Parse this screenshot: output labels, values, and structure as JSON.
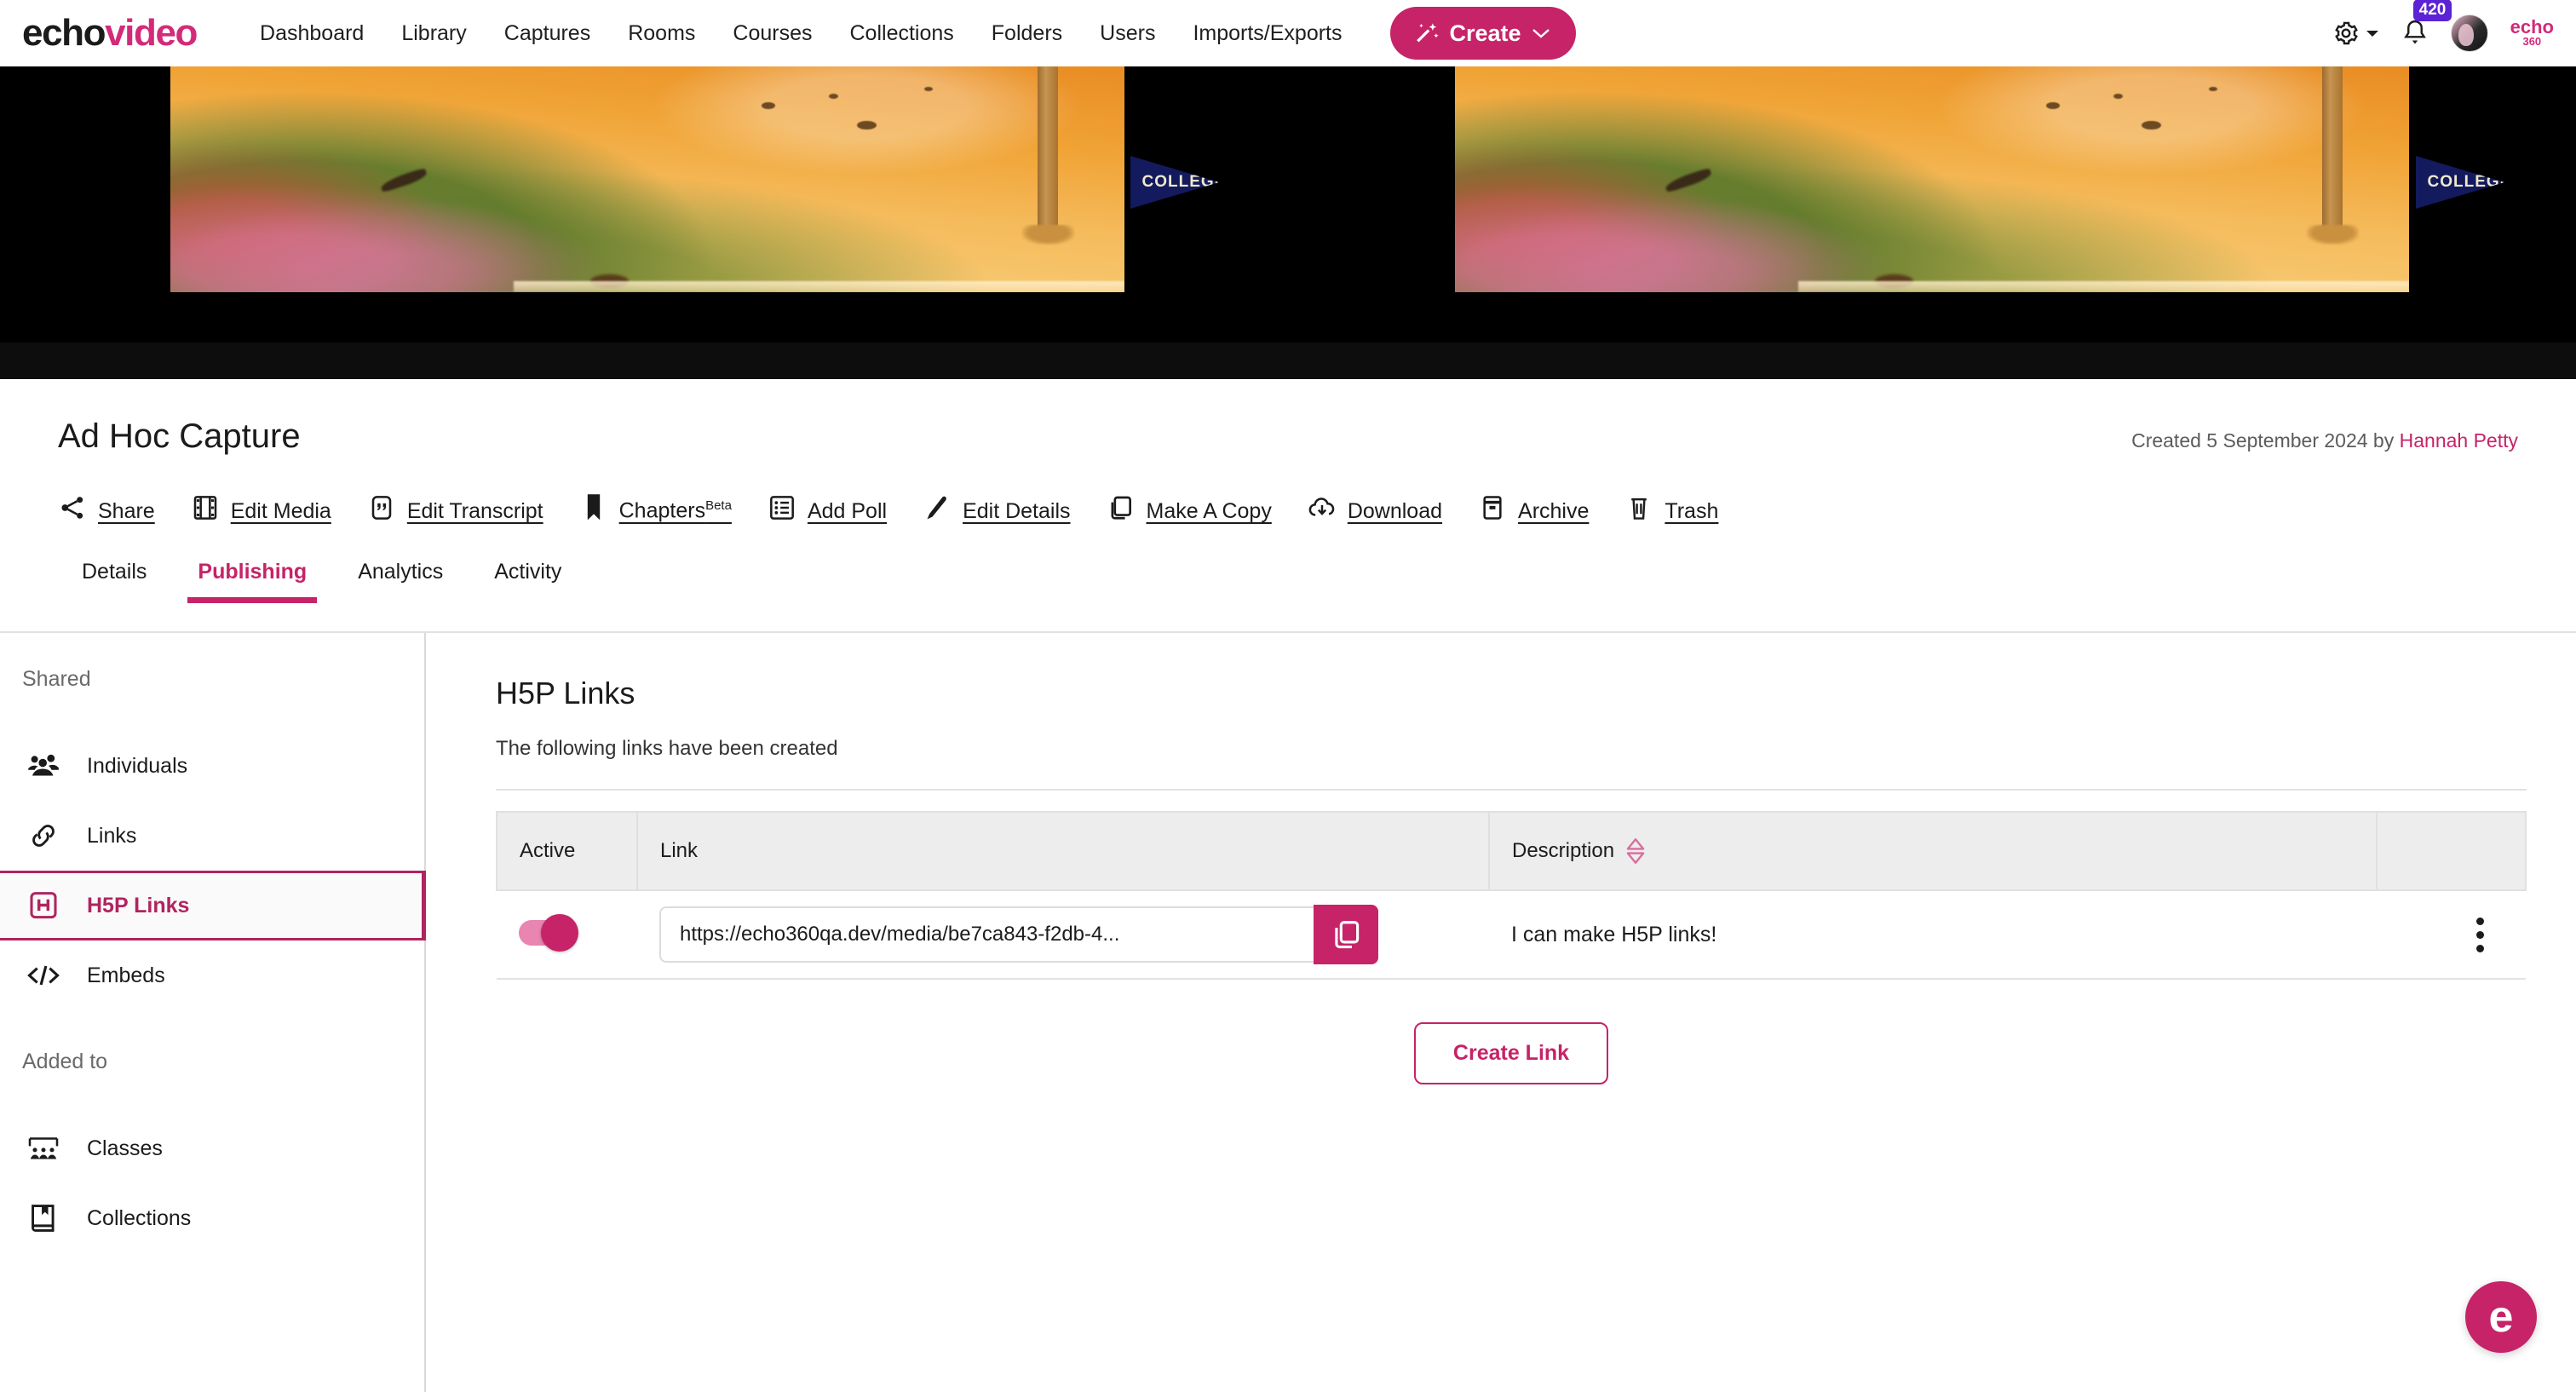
{
  "nav": {
    "logo_echo": "echo",
    "logo_video": "video",
    "links": [
      {
        "label": "Dashboard"
      },
      {
        "label": "Library"
      },
      {
        "label": "Captures"
      },
      {
        "label": "Rooms"
      },
      {
        "label": "Courses"
      },
      {
        "label": "Collections"
      },
      {
        "label": "Folders"
      },
      {
        "label": "Users"
      },
      {
        "label": "Imports/Exports"
      }
    ],
    "create_label": "Create",
    "create_caret": "⌄",
    "notification_count": "420",
    "brand_mark": "echo",
    "brand_mark_sub": "360"
  },
  "video": {
    "pennant_text_left": "COLLEGE",
    "pennant_text_right": "COLLEGE"
  },
  "detail": {
    "title": "Ad Hoc Capture",
    "created_prefix": "Created 5 September 2024 by ",
    "created_author": "Hannah Petty"
  },
  "actions": [
    {
      "label": "Share",
      "icon": "share-icon"
    },
    {
      "label": "Edit Media",
      "icon": "film-icon"
    },
    {
      "label": "Edit Transcript",
      "icon": "quote-icon"
    },
    {
      "label": "Chapters",
      "sup": "Beta",
      "icon": "bookmark-icon"
    },
    {
      "label": "Add Poll",
      "icon": "list-icon"
    },
    {
      "label": "Edit Details",
      "icon": "pencil-icon"
    },
    {
      "label": "Make A Copy",
      "icon": "copy-icon"
    },
    {
      "label": "Download",
      "icon": "download-cloud-icon"
    },
    {
      "label": "Archive",
      "icon": "archive-icon"
    },
    {
      "label": "Trash",
      "icon": "trash-icon"
    }
  ],
  "tabs": [
    {
      "label": "Details",
      "active": false
    },
    {
      "label": "Publishing",
      "active": true
    },
    {
      "label": "Analytics",
      "active": false
    },
    {
      "label": "Activity",
      "active": false
    }
  ],
  "sidebar": {
    "group_shared": "Shared",
    "group_added_to": "Added to",
    "shared_items": [
      {
        "label": "Individuals",
        "icon": "people-icon",
        "active": false
      },
      {
        "label": "Links",
        "icon": "link-icon",
        "active": false
      },
      {
        "label": "H5P Links",
        "icon": "h5p-icon",
        "active": true
      },
      {
        "label": "Embeds",
        "icon": "code-icon",
        "active": false
      }
    ],
    "added_items": [
      {
        "label": "Classes",
        "icon": "classroom-icon",
        "active": false
      },
      {
        "label": "Collections",
        "icon": "book-icon",
        "active": false
      }
    ]
  },
  "main": {
    "heading": "H5P Links",
    "subheading": "The following links have been created",
    "table": {
      "headers": [
        "Active",
        "Link",
        "Description",
        ""
      ],
      "rows": [
        {
          "active": true,
          "link_value": "https://echo360qa.dev/media/be7ca843-f2db-4...",
          "link_placeholder": "Link",
          "description": "I can make H5P links!"
        }
      ]
    },
    "create_link_label": "Create Link"
  },
  "fab": {
    "label": "e"
  },
  "colors": {
    "brand_pink": "#c62368",
    "brand_pink_dark": "#b0245f",
    "badge_purple": "#5b22d6",
    "header_grey": "#ededed"
  }
}
